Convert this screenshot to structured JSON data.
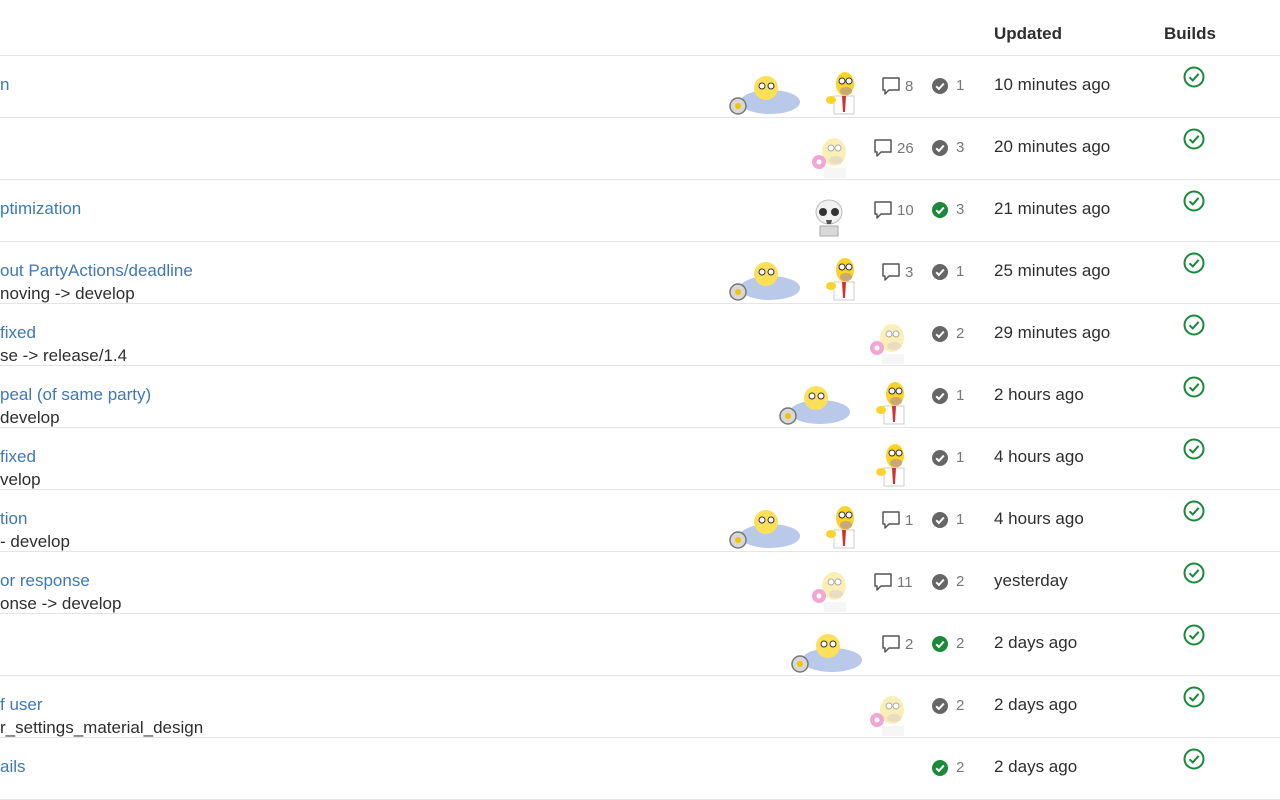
{
  "header": {
    "updated": "Updated",
    "builds": "Builds"
  },
  "colors": {
    "link": "#3f78b5",
    "success": "#1a8a3a",
    "neutral": "#666666"
  },
  "rows": [
    {
      "title": "n",
      "branch": "",
      "comments": "8",
      "pipeline": "1",
      "pipeline_status": "neutral",
      "updated": "10 minutes ago",
      "avatars": [
        "grandpa-avatar",
        "homer-avatar"
      ]
    },
    {
      "title": "",
      "branch": "",
      "comments": "26",
      "pipeline": "3",
      "pipeline_status": "neutral",
      "updated": "20 minutes ago",
      "avatars": [
        "homer-donut-avatar"
      ]
    },
    {
      "title": "ptimization",
      "branch": "",
      "comments": "10",
      "pipeline": "3",
      "pipeline_status": "success",
      "updated": "21 minutes ago",
      "avatars": [
        "skull-avatar"
      ]
    },
    {
      "title": "out PartyActions/deadline",
      "branch": "noving -> develop",
      "comments": "3",
      "pipeline": "1",
      "pipeline_status": "neutral",
      "updated": "25 minutes ago",
      "avatars": [
        "grandpa-avatar",
        "homer-avatar"
      ]
    },
    {
      "title": "fixed",
      "branch": "se -> release/1.4",
      "comments": "",
      "pipeline": "2",
      "pipeline_status": "neutral",
      "updated": "29 minutes ago",
      "avatars": [
        "homer-donut-avatar"
      ]
    },
    {
      "title": "peal (of same party)",
      "branch": "develop",
      "comments": "",
      "pipeline": "1",
      "pipeline_status": "neutral",
      "updated": "2 hours ago",
      "avatars": [
        "grandpa-avatar",
        "homer-avatar"
      ]
    },
    {
      "title": "fixed",
      "branch": "velop",
      "comments": "",
      "pipeline": "1",
      "pipeline_status": "neutral",
      "updated": "4 hours ago",
      "avatars": [
        "homer-avatar"
      ]
    },
    {
      "title": "tion",
      "branch": "- develop",
      "comments": "1",
      "pipeline": "1",
      "pipeline_status": "neutral",
      "updated": "4 hours ago",
      "avatars": [
        "grandpa-avatar",
        "homer-avatar"
      ]
    },
    {
      "title": "or response",
      "branch": "onse -> develop",
      "comments": "11",
      "pipeline": "2",
      "pipeline_status": "neutral",
      "updated": "yesterday",
      "avatars": [
        "homer-donut-avatar"
      ]
    },
    {
      "title": "",
      "branch": "",
      "comments": "2",
      "pipeline": "2",
      "pipeline_status": "success",
      "updated": "2 days ago",
      "avatars": [
        "grandpa-avatar"
      ]
    },
    {
      "title": "f user",
      "branch": "r_settings_material_design",
      "comments": "",
      "pipeline": "2",
      "pipeline_status": "neutral",
      "updated": "2 days ago",
      "avatars": [
        "homer-donut-avatar"
      ]
    },
    {
      "title": "ails",
      "branch": "",
      "comments": "",
      "pipeline": "2",
      "pipeline_status": "success",
      "updated": "2 days ago",
      "avatars": []
    }
  ]
}
